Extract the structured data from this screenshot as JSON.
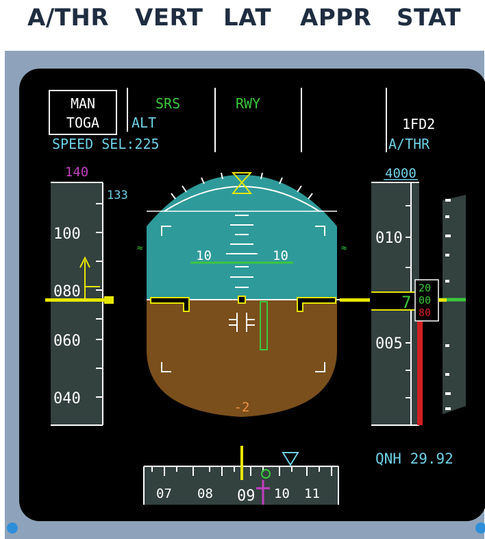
{
  "header": {
    "labels": [
      "A/THR",
      "VERT",
      "LAT",
      "APPR",
      "STAT"
    ]
  },
  "fma": {
    "col1_box_line1": "MAN",
    "col1_box_line2": "TOGA",
    "col1_line3": "SPEED SEL:225",
    "col2_line1": "SRS",
    "col2_line2": "ALT",
    "col3_line1": "RWY",
    "col5_line2": "1FD2",
    "col5_line3": "A/THR"
  },
  "speed_tape": {
    "target": "140",
    "overspeed_value": "133",
    "labels": [
      "100",
      "080",
      "060",
      "040"
    ]
  },
  "attitude": {
    "pitch_label_left": "10",
    "pitch_label_right": "10",
    "pitch_value": "-2"
  },
  "altitude_tape": {
    "selected": "4000",
    "labels": [
      "010",
      "005"
    ],
    "readout_big": "7",
    "readout_drum": [
      "20",
      "00",
      "80"
    ]
  },
  "heading": {
    "labels": [
      "07",
      "08",
      "09",
      "10",
      "11"
    ]
  },
  "baro": {
    "qnh": "QNH 29.92"
  },
  "colors": {
    "sky": "#2f9a9a",
    "ground": "#7a4f1c",
    "green": "#3cc83c",
    "cyan": "#6fd0e6",
    "magenta": "#c040c0",
    "yellow": "#e6e600",
    "amber": "#f09040",
    "red": "#d02020"
  }
}
